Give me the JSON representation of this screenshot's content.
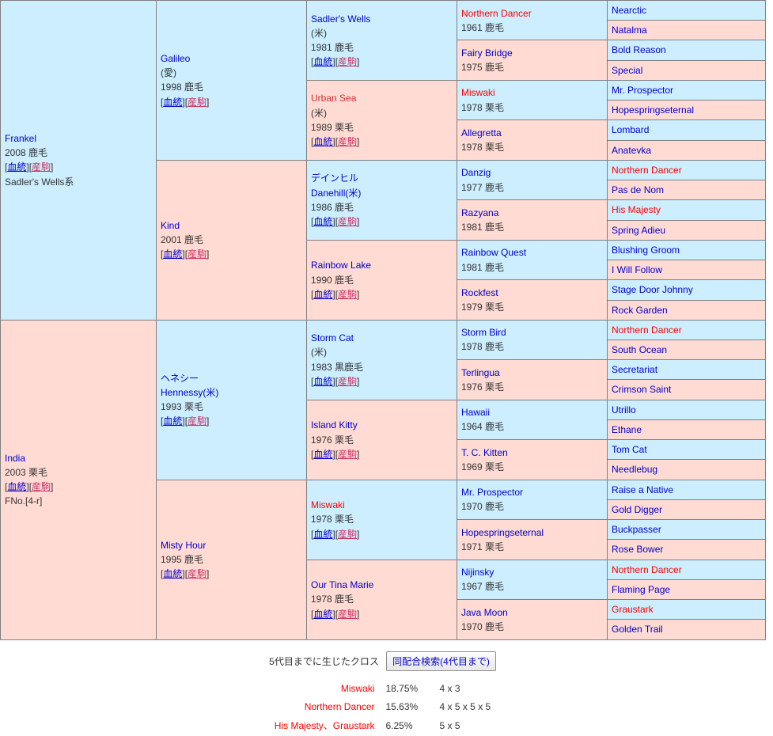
{
  "pedigree": {
    "subject": {
      "name": "Frankel",
      "meta": "2008 鹿毛",
      "links": "[血統][産駒]",
      "link_blood": "血統",
      "link_foal": "産駒",
      "line": "Sadler's Wells系",
      "sex": "sire"
    },
    "dam_subject": {
      "name": "India",
      "meta": "2003 栗毛",
      "links": "[血統][産駒]",
      "fno": "FNo.[4-r]",
      "sex": "dam"
    },
    "gen2": [
      {
        "name": "Galileo",
        "jp": "",
        "origin": "(愛)",
        "meta": "1998 鹿毛",
        "links": "[血統][産駒]",
        "sex": "sire"
      },
      {
        "name": "Kind",
        "jp": "",
        "origin": "",
        "meta": "2001 鹿毛",
        "links": "[血統][産駒]",
        "sex": "dam"
      },
      {
        "name": "Hennessy(米)",
        "jp": "ヘネシー",
        "origin": "",
        "meta": "1993 栗毛",
        "links": "[血統][産駒]",
        "sex": "sire"
      },
      {
        "name": "Misty Hour",
        "jp": "",
        "origin": "",
        "meta": "1995 鹿毛",
        "links": "[血統][産駒]",
        "sex": "dam"
      }
    ],
    "gen3": [
      {
        "name": "Sadler's Wells",
        "jp": "",
        "origin": "(米)",
        "meta": "1981 鹿毛",
        "links": "[血統][産駒]",
        "sex": "sire",
        "highlight": false
      },
      {
        "name": "Urban Sea",
        "jp": "",
        "origin": "(米)",
        "meta": "1989 栗毛",
        "links": "[血統][産駒]",
        "sex": "dam",
        "highlight": "alt"
      },
      {
        "name": "Danehill(米)",
        "jp": "デインヒル",
        "origin": "",
        "meta": "1986 鹿毛",
        "links": "[血統][産駒]",
        "sex": "sire",
        "highlight": false
      },
      {
        "name": "Rainbow Lake",
        "jp": "",
        "origin": "",
        "meta": "1990 鹿毛",
        "links": "[血統][産駒]",
        "sex": "dam",
        "highlight": false
      },
      {
        "name": "Storm Cat",
        "jp": "",
        "origin": "(米)",
        "meta": "1983 黒鹿毛",
        "links": "[血統][産駒]",
        "sex": "sire",
        "highlight": false
      },
      {
        "name": "Island Kitty",
        "jp": "",
        "origin": "",
        "meta": "1976 栗毛",
        "links": "[血統][産駒]",
        "sex": "dam",
        "highlight": false
      },
      {
        "name": "Miswaki",
        "jp": "",
        "origin": "",
        "meta": "1978 栗毛",
        "links": "[血統][産駒]",
        "sex": "sire",
        "highlight": "crossed"
      },
      {
        "name": "Our Tina Marie",
        "jp": "",
        "origin": "",
        "meta": "1978 鹿毛",
        "links": "[血統][産駒]",
        "sex": "dam",
        "highlight": false
      }
    ],
    "gen4": [
      {
        "name": "Northern Dancer",
        "meta": "1961 鹿毛",
        "sex": "sire",
        "highlight": "crossed"
      },
      {
        "name": "Fairy Bridge",
        "meta": "1975 鹿毛",
        "sex": "dam",
        "highlight": false
      },
      {
        "name": "Miswaki",
        "meta": "1978 栗毛",
        "sex": "sire",
        "highlight": "crossed"
      },
      {
        "name": "Allegretta",
        "meta": "1978 栗毛",
        "sex": "dam",
        "highlight": false
      },
      {
        "name": "Danzig",
        "meta": "1977 鹿毛",
        "sex": "sire",
        "highlight": false
      },
      {
        "name": "Razyana",
        "meta": "1981 鹿毛",
        "sex": "dam",
        "highlight": false
      },
      {
        "name": "Rainbow Quest",
        "meta": "1981 鹿毛",
        "sex": "sire",
        "highlight": false
      },
      {
        "name": "Rockfest",
        "meta": "1979 栗毛",
        "sex": "dam",
        "highlight": false
      },
      {
        "name": "Storm Bird",
        "meta": "1978 鹿毛",
        "sex": "sire",
        "highlight": false
      },
      {
        "name": "Terlingua",
        "meta": "1976 栗毛",
        "sex": "dam",
        "highlight": false
      },
      {
        "name": "Hawaii",
        "meta": "1964 鹿毛",
        "sex": "sire",
        "highlight": false
      },
      {
        "name": "T. C. Kitten",
        "meta": "1969 栗毛",
        "sex": "dam",
        "highlight": false
      },
      {
        "name": "Mr. Prospector",
        "meta": "1970 鹿毛",
        "sex": "sire",
        "highlight": false
      },
      {
        "name": "Hopespringseternal",
        "meta": "1971 栗毛",
        "sex": "dam",
        "highlight": false
      },
      {
        "name": "Nijinsky",
        "meta": "1967 鹿毛",
        "sex": "sire",
        "highlight": false
      },
      {
        "name": "Java Moon",
        "meta": "1970 鹿毛",
        "sex": "dam",
        "highlight": false
      }
    ],
    "gen5": [
      {
        "name": "Nearctic",
        "sex": "sire",
        "highlight": false
      },
      {
        "name": "Natalma",
        "sex": "dam",
        "highlight": false
      },
      {
        "name": "Bold Reason",
        "sex": "sire",
        "highlight": false
      },
      {
        "name": "Special",
        "sex": "dam",
        "highlight": false
      },
      {
        "name": "Mr. Prospector",
        "sex": "sire",
        "highlight": false
      },
      {
        "name": "Hopespringseternal",
        "sex": "dam",
        "highlight": false
      },
      {
        "name": "Lombard",
        "sex": "sire",
        "highlight": false
      },
      {
        "name": "Anatevka",
        "sex": "dam",
        "highlight": false
      },
      {
        "name": "Northern Dancer",
        "sex": "sire",
        "highlight": "crossed"
      },
      {
        "name": "Pas de Nom",
        "sex": "dam",
        "highlight": false
      },
      {
        "name": "His Majesty",
        "sex": "sire",
        "highlight": "crossed"
      },
      {
        "name": "Spring Adieu",
        "sex": "dam",
        "highlight": false
      },
      {
        "name": "Blushing Groom",
        "sex": "sire",
        "highlight": false
      },
      {
        "name": "I Will Follow",
        "sex": "dam",
        "highlight": false
      },
      {
        "name": "Stage Door Johnny",
        "sex": "sire",
        "highlight": false
      },
      {
        "name": "Rock Garden",
        "sex": "dam",
        "highlight": false
      },
      {
        "name": "Northern Dancer",
        "sex": "sire",
        "highlight": "crossed"
      },
      {
        "name": "South Ocean",
        "sex": "dam",
        "highlight": false
      },
      {
        "name": "Secretariat",
        "sex": "sire",
        "highlight": false
      },
      {
        "name": "Crimson Saint",
        "sex": "dam",
        "highlight": false
      },
      {
        "name": "Utrillo",
        "sex": "sire",
        "highlight": false
      },
      {
        "name": "Ethane",
        "sex": "dam",
        "highlight": false
      },
      {
        "name": "Tom Cat",
        "sex": "sire",
        "highlight": false
      },
      {
        "name": "Needlebug",
        "sex": "dam",
        "highlight": false
      },
      {
        "name": "Raise a Native",
        "sex": "sire",
        "highlight": false
      },
      {
        "name": "Gold Digger",
        "sex": "dam",
        "highlight": false
      },
      {
        "name": "Buckpasser",
        "sex": "sire",
        "highlight": false
      },
      {
        "name": "Rose Bower",
        "sex": "dam",
        "highlight": false
      },
      {
        "name": "Northern Dancer",
        "sex": "sire",
        "highlight": "crossed"
      },
      {
        "name": "Flaming Page",
        "sex": "dam",
        "highlight": false
      },
      {
        "name": "Graustark",
        "sex": "sire",
        "highlight": "crossed"
      },
      {
        "name": "Golden Trail",
        "sex": "dam",
        "highlight": false
      }
    ]
  },
  "cross": {
    "label": "5代目までに生じたクロス",
    "button_label": "同配合検索(4代目まで)",
    "rows": [
      {
        "name": "Miswaki",
        "percent": "18.75%",
        "generations": "4 x 3"
      },
      {
        "name": "Northern Dancer",
        "percent": "15.63%",
        "generations": "4 x 5 x 5 x 5"
      },
      {
        "name": "His Majesty、Graustark",
        "percent": "6.25%",
        "generations": "5 x 5"
      }
    ]
  },
  "colors": {
    "sire_bg": "#cceeff",
    "dam_bg": "#ffdbd4",
    "link": "#0000cc",
    "cross": "#ff0000",
    "border": "#808080"
  }
}
